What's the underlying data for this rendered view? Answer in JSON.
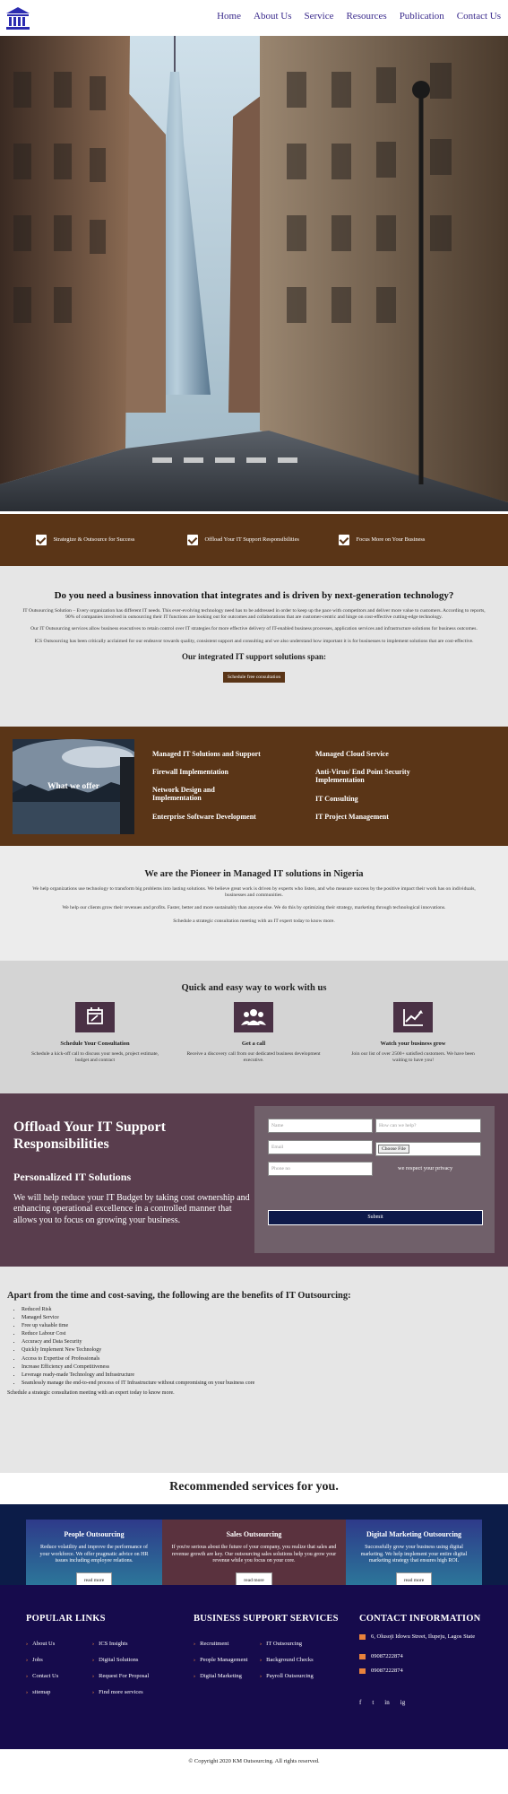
{
  "header": {
    "logo_icon": "institution-columns-icon",
    "nav": [
      "Home",
      "About Us",
      "Service",
      "Resources",
      "Publication",
      "Contact Us"
    ]
  },
  "strip": {
    "items": [
      "Strategize & Outsource for Success",
      "Offload Your IT Support Responsibilities",
      "Focus More on Your Business"
    ]
  },
  "innovation": {
    "title": "Do you need a business innovation that integrates and is driven by next-generation technology?",
    "p1": "IT Outsourcing Solution – Every organization has different IT needs. This ever-evolving technology need has to be addressed in order to keep up the pace with competitors and deliver more value to customers. According to reports, 90% of companies involved in outsourcing their IT functions are looking out for outcomes and collaborations that are customer-centric and hinge on cost-effective cutting-edge technology.",
    "p2": "Our IT Outsourcing services allow business executives to retain control over IT strategies for more effective delivery of IT-enabled business processes, application services and infrastructure solutions for business outcomes.",
    "p3": "ICS Outsourcing has been critically acclaimed for our endeavor towards quality, consistent support and consulting and we also understand how important it is for businesses to implement solutions that are cost-effective.",
    "subtitle": "Our integrated IT support solutions span:",
    "button": "Schedule free consultation"
  },
  "services": {
    "image_label": "What we offer",
    "left": [
      "Managed IT Solutions and Support",
      "Firewall Implementation",
      "Network Design and Implementation",
      "Enterprise Software Development"
    ],
    "right": [
      "Managed Cloud Service",
      "Anti-Virus/ End Point Security Implementation",
      "IT Consulting",
      "IT Project Management"
    ]
  },
  "pioneer": {
    "title": "We are the Pioneer in Managed IT solutions in Nigeria",
    "p1": "We help organizations use technology to transform big problems into lasting solutions. We believe great work is driven by experts who listen, and who measure success by the positive impact their work has on individuals, businesses and communities.",
    "p2": "We help our clients grow their revenues and profits. Faster, better and more sustainably than anyone else. We do this by optimizing their strategy, marketing through technological innovations.",
    "p3": "Schedule a strategic consultation meeting with an IT expert today to know more."
  },
  "quick": {
    "title": "Quick and easy way to work with us",
    "steps": [
      {
        "icon": "calendar-edit-icon",
        "title": "Schedule Your Consultation",
        "text": "Schedule a kick-off call to discuss your needs, project estimate, budget and contract"
      },
      {
        "icon": "users-group-icon",
        "title": "Get a call",
        "text": "Receive a discovery call from our dedicated business development executive."
      },
      {
        "icon": "chart-growth-icon",
        "title": "Watch your business grow",
        "text": "Join our list of over 2500+ satisfied customers. We have been waiting to have you!"
      }
    ]
  },
  "offload": {
    "title": "Offload Your IT Support Responsibilities",
    "subtitle": "Personalized IT Solutions",
    "text": "We will help reduce your IT Budget by taking cost ownership and enhancing operational excellence in a controlled manner that allows you to focus on growing your business.",
    "form": {
      "name_placeholder": "Name",
      "help_placeholder": "How can we help?",
      "email_placeholder": "Email",
      "file_label": "Choose File",
      "file_status": "",
      "phone_placeholder": "Phone no",
      "privacy": "we respect your privacy",
      "submit": "Submit"
    }
  },
  "benefits": {
    "title": "Apart from the time and cost-saving, the following are the benefits of IT Outsourcing:",
    "items": [
      "Reduced Risk",
      "Managed Service",
      "Free up valuable time",
      "Reduce Labour Cost",
      "Accuracy and Data Security",
      "Quickly Implement New Technology",
      "Access to Expertise of Professionals",
      "Increase Efficiency and Competitiveness",
      "Leverage ready-made Technology and Infrastructure",
      "Seamlessly manage the end-to-end process of IT Infrastructure without compromising on your business core"
    ],
    "footer": "Schedule a strategic consultation meeting with an expert today to know more."
  },
  "recommended": {
    "title": "Recommended services for you.",
    "cards": [
      {
        "title": "People Outsourcing",
        "text": "Reduce volatility and improve the performance of your workforce. We offer pragmatic advice on HR issues including employee relations.",
        "button": "read more"
      },
      {
        "title": "Sales Outsourcing",
        "text": "If you're serious about the future of your company, you realize that sales and revenue growth are key. Our outsourcing sales solutions help you grow your revenue while you focus on your core.",
        "button": "read more"
      },
      {
        "title": "Digital Marketing Outsourcing",
        "text": "Successfully grow your business using digital marketing. We help implement your entire digital marketing strategy that ensures high ROI.",
        "button": "read more"
      }
    ]
  },
  "footer": {
    "popular_title": "POPULAR LINKS",
    "popular": [
      "About Us",
      "Jobs",
      "Contact Us",
      "sitemap"
    ],
    "popular2": [
      "ICS Insights",
      "Digital Solutions",
      "Request For Proposal",
      "Find more services"
    ],
    "support_title": "BUSINESS SUPPORT SERVICES",
    "support": [
      "Recruitment",
      "People Management",
      "Digital Marketing"
    ],
    "support2": [
      "IT Outsourcing",
      "Background Checks",
      "Payroll Outsourcing"
    ],
    "contact_title": "CONTACT INFORMATION",
    "address": "6, Olusoji Idowu Street, Ilupeju, Lagos State",
    "phone1": "09087222874",
    "phone2": "09087222874",
    "social": [
      "f",
      "t",
      "in",
      "ig"
    ]
  },
  "copyright": "© Copyright 2020 KM Outsourcing. All rights reserved."
}
